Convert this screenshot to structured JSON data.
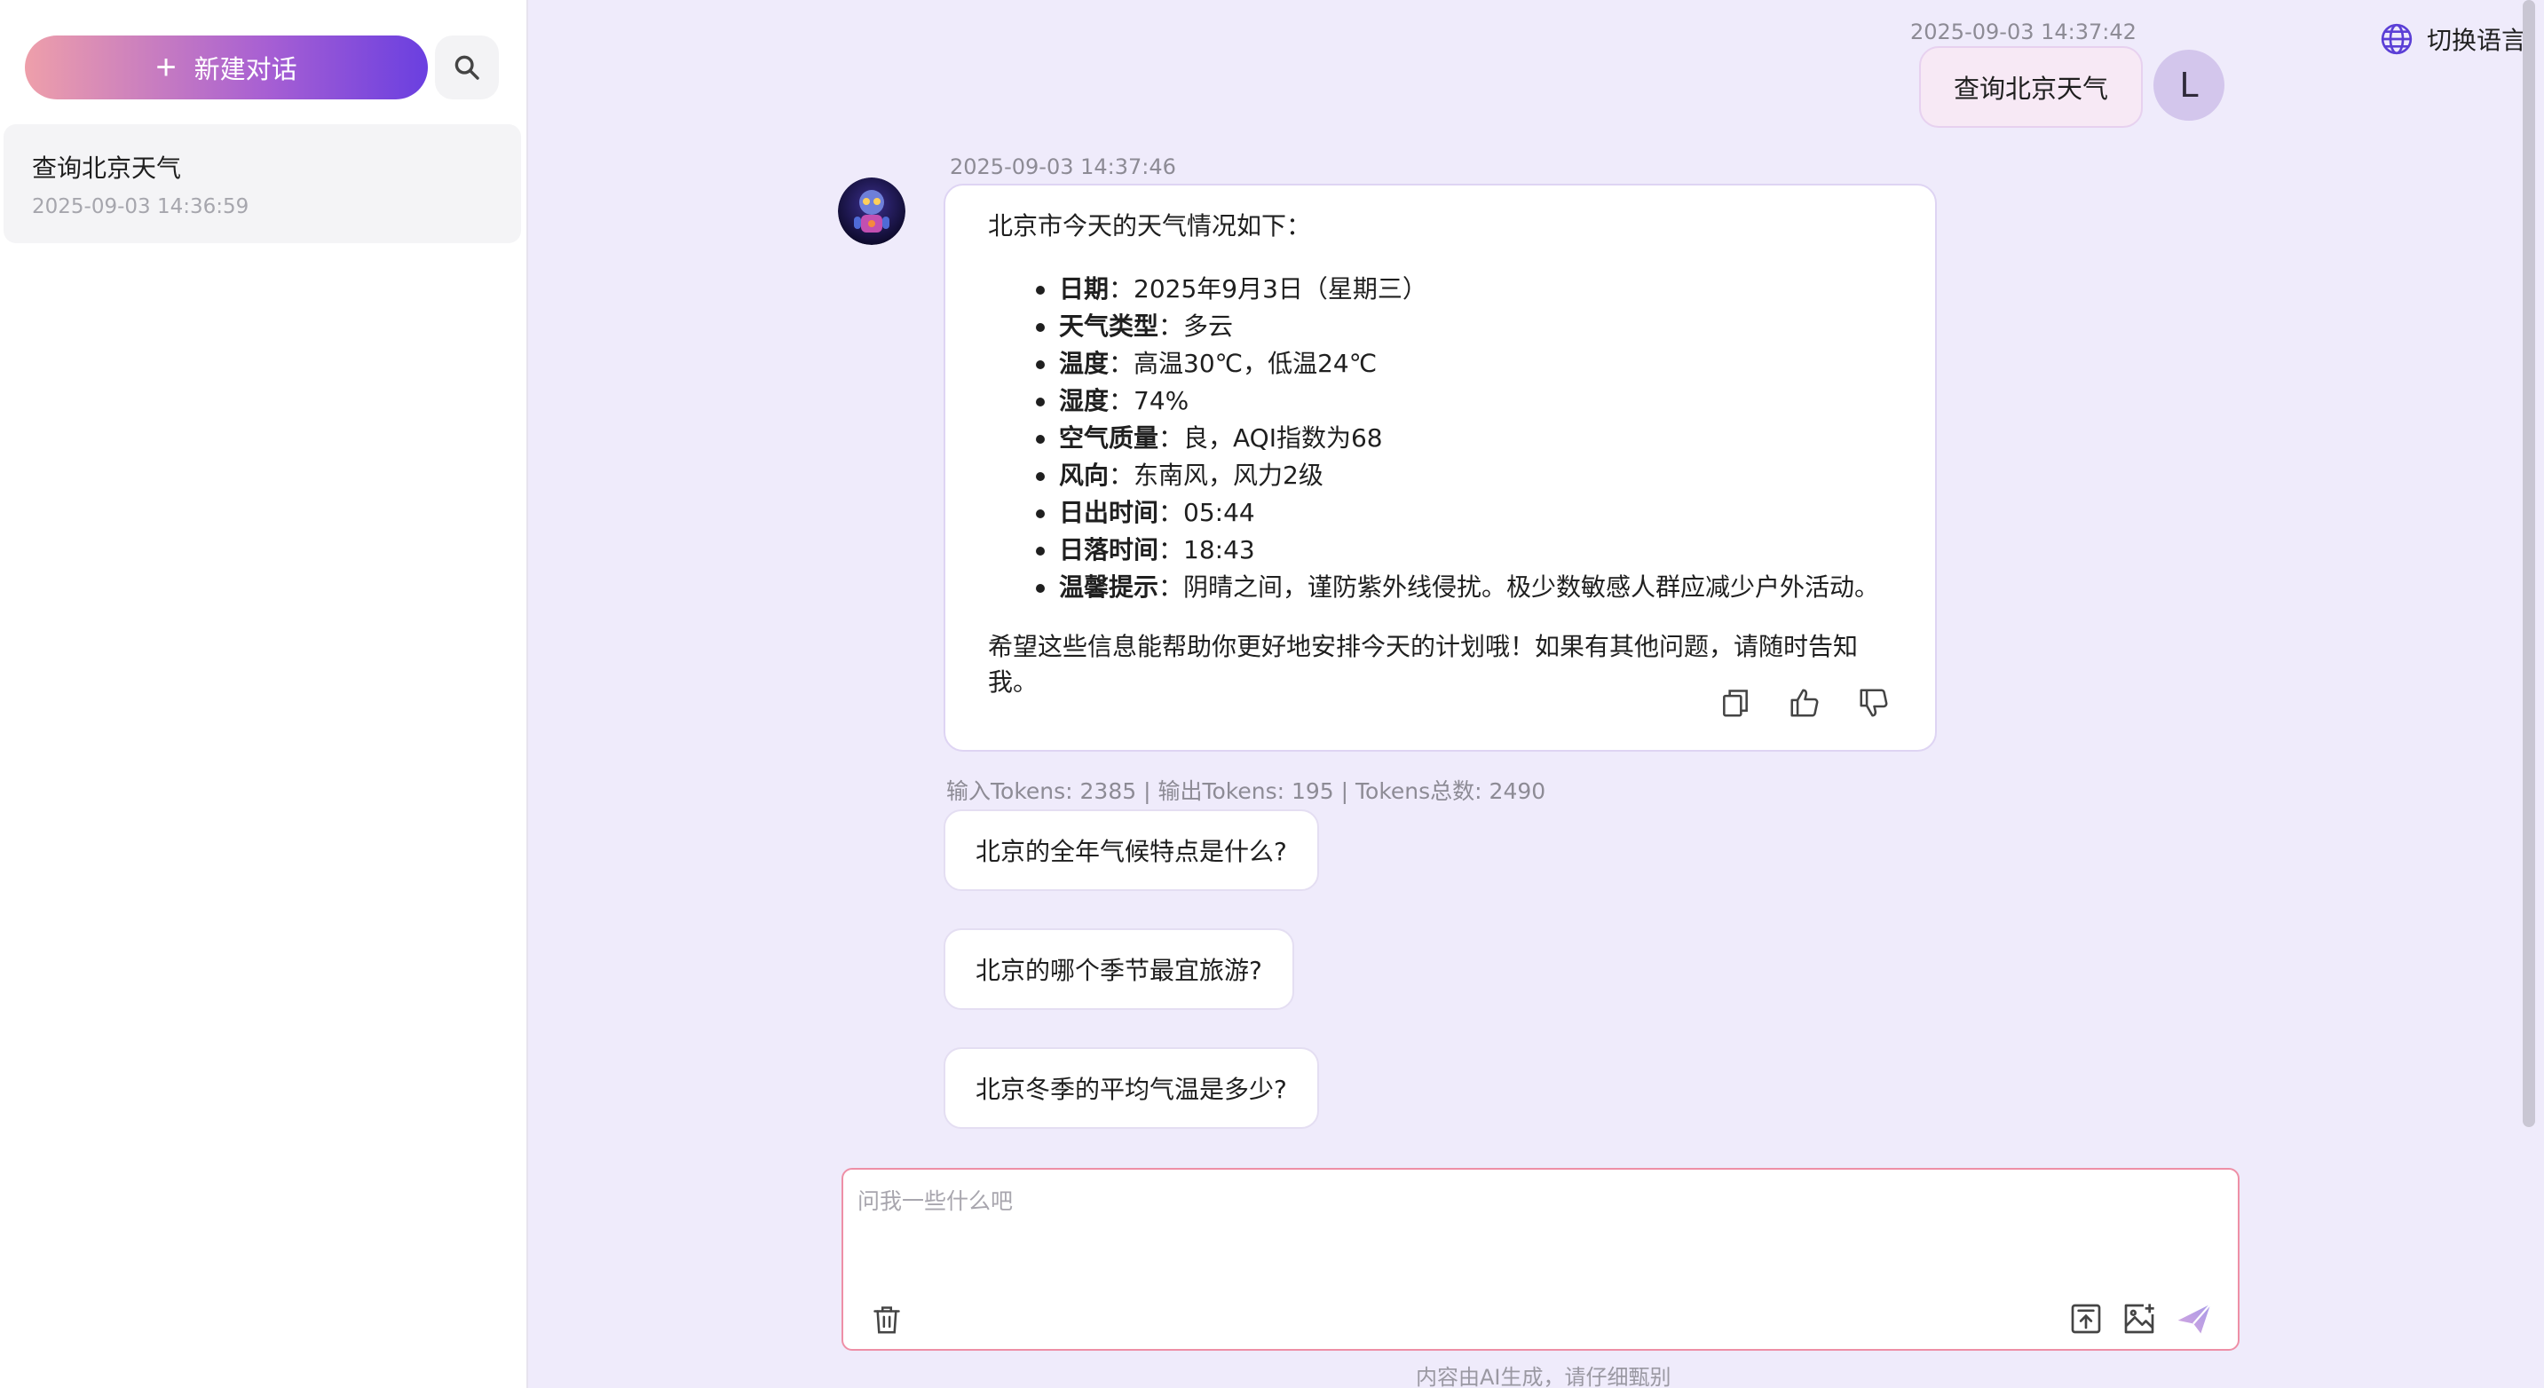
{
  "sidebar": {
    "new_chat_label": "新建对话",
    "conversations": [
      {
        "title": "查询北京天气",
        "time": "2025-09-03 14:36:59"
      }
    ]
  },
  "header": {
    "language_switch_label": "切换语言"
  },
  "user_message": {
    "time": "2025-09-03 14:37:42",
    "text": "查询北京天气",
    "avatar_letter": "L"
  },
  "bot_message": {
    "time": "2025-09-03 14:37:46",
    "intro": "北京市今天的天气情况如下：",
    "items": [
      {
        "key": "日期",
        "value": "：2025年9月3日（星期三）"
      },
      {
        "key": "天气类型",
        "value": "：多云"
      },
      {
        "key": "温度",
        "value": "：高温30℃，低温24℃"
      },
      {
        "key": "湿度",
        "value": "：74%"
      },
      {
        "key": "空气质量",
        "value": "：良，AQI指数为68"
      },
      {
        "key": "风向",
        "value": "：东南风，风力2级"
      },
      {
        "key": "日出时间",
        "value": "：05:44"
      },
      {
        "key": "日落时间",
        "value": "：18:43"
      },
      {
        "key": "温馨提示",
        "value": "：阴晴之间，谨防紫外线侵扰。极少数敏感人群应减少户外活动。"
      }
    ],
    "outro": "希望这些信息能帮助你更好地安排今天的计划哦！如果有其他问题，请随时告知我。",
    "tokens": "输入Tokens: 2385 |  输出Tokens: 195 |  Tokens总数: 2490"
  },
  "suggestions": [
    "北京的全年气候特点是什么?",
    "北京的哪个季节最宜旅游?",
    "北京冬季的平均气温是多少?"
  ],
  "input": {
    "placeholder": "问我一些什么吧",
    "value": ""
  },
  "disclaimer": "内容由AI生成，请仔细甄别",
  "colors": {
    "accent_gradient_start": "#ee9faa",
    "accent_gradient_end": "#6a3fe0",
    "page_background": "#efebfb",
    "input_border": "#ee8fa6"
  },
  "icons": {
    "new_chat": "plus-icon",
    "search": "search-icon",
    "language": "globe-icon",
    "copy": "copy-icon",
    "like": "thumbs-up-icon",
    "dislike": "thumbs-down-icon",
    "clear": "trash-icon",
    "upload": "upload-icon",
    "image": "image-add-icon",
    "send": "send-icon"
  }
}
